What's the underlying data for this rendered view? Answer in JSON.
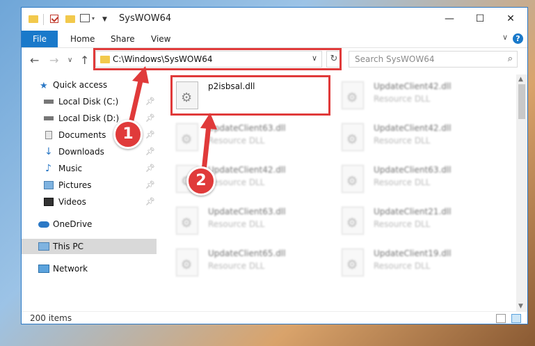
{
  "window": {
    "title": "SysWOW64",
    "minimize": "—",
    "maximize": "☐",
    "close": "✕"
  },
  "ribbon": {
    "file": "File",
    "tabs": [
      "Home",
      "Share",
      "View"
    ],
    "help": "?",
    "collapse": "∨"
  },
  "nav": {
    "back": "←",
    "forward": "→",
    "recent": "∨",
    "up": "↑",
    "address": "C:\\Windows\\SysWOW64",
    "search_placeholder": "Search SysWOW64"
  },
  "sidebar": {
    "items": [
      {
        "label": "Quick access",
        "icon": "star-icon"
      },
      {
        "label": "Local Disk (C:)",
        "icon": "drive-icon",
        "pinned": true
      },
      {
        "label": "Local Disk (D:)",
        "icon": "drive-icon",
        "pinned": true
      },
      {
        "label": "Documents",
        "icon": "documents-icon",
        "pinned": true
      },
      {
        "label": "Downloads",
        "icon": "downloads-icon",
        "pinned": true
      },
      {
        "label": "Music",
        "icon": "music-icon",
        "pinned": true
      },
      {
        "label": "Pictures",
        "icon": "pictures-icon",
        "pinned": true
      },
      {
        "label": "Videos",
        "icon": "videos-icon",
        "pinned": true
      },
      {
        "label": "OneDrive",
        "icon": "cloud-icon"
      },
      {
        "label": "This PC",
        "icon": "computer-icon",
        "selected": true
      },
      {
        "label": "Network",
        "icon": "network-icon"
      }
    ]
  },
  "files": [
    {
      "name": "p2isbsal.dll",
      "type": ""
    },
    {
      "name": "UpdateClient42.dll",
      "type": "Resource DLL"
    },
    {
      "name": "UpdateClient63.dll",
      "type": "Resource DLL"
    },
    {
      "name": "UpdateClient42.dll",
      "type": "Resource DLL"
    },
    {
      "name": "UpdateClient42.dll",
      "type": "Resource DLL"
    },
    {
      "name": "UpdateClient63.dll",
      "type": "Resource DLL"
    },
    {
      "name": "UpdateClient63.dll",
      "type": "Resource DLL"
    },
    {
      "name": "UpdateClient21.dll",
      "type": "Resource DLL"
    },
    {
      "name": "UpdateClient65.dll",
      "type": "Resource DLL"
    },
    {
      "name": "UpdateClient19.dll",
      "type": "Resource DLL"
    }
  ],
  "status": {
    "count": "200 items"
  },
  "annotations": {
    "step1": "1",
    "step2": "2",
    "color": "#e03a3a"
  }
}
